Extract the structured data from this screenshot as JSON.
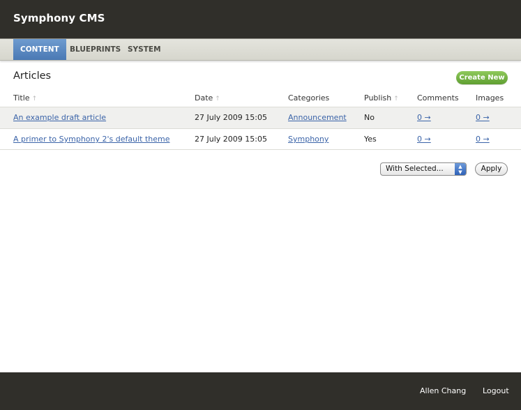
{
  "header": {
    "app_title": "Symphony CMS"
  },
  "nav": {
    "tabs": [
      {
        "label": "CONTENT",
        "active": true
      },
      {
        "label": "BLUEPRINTS",
        "active": false
      },
      {
        "label": "SYSTEM",
        "active": false
      }
    ]
  },
  "section": {
    "title": "Articles",
    "create_label": "Create New"
  },
  "table": {
    "columns": [
      "Title",
      "Date",
      "Categories",
      "Publish",
      "Comments",
      "Images"
    ],
    "rows": [
      {
        "title": "An example draft article",
        "date": "27 July 2009 15:05",
        "category": "Announcement",
        "publish": "No",
        "comments": "0 →",
        "images": "0 →"
      },
      {
        "title": "A primer to Symphony 2's default theme",
        "date": "27 July 2009 15:05",
        "category": "Symphony",
        "publish": "Yes",
        "comments": "0 →",
        "images": "0 →"
      }
    ]
  },
  "actions": {
    "with_selected": "With Selected...",
    "apply_label": "Apply"
  },
  "footer": {
    "user_name": "Allen Chang",
    "logout_label": "Logout"
  },
  "colors": {
    "header_bg": "#302f2a",
    "active_tab": "#4a79b4",
    "create_button": "#6fae3f",
    "link": "#3a63a8"
  },
  "icons": {
    "sort": "sort-arrow-icon",
    "select": "select-stepper-icon"
  }
}
